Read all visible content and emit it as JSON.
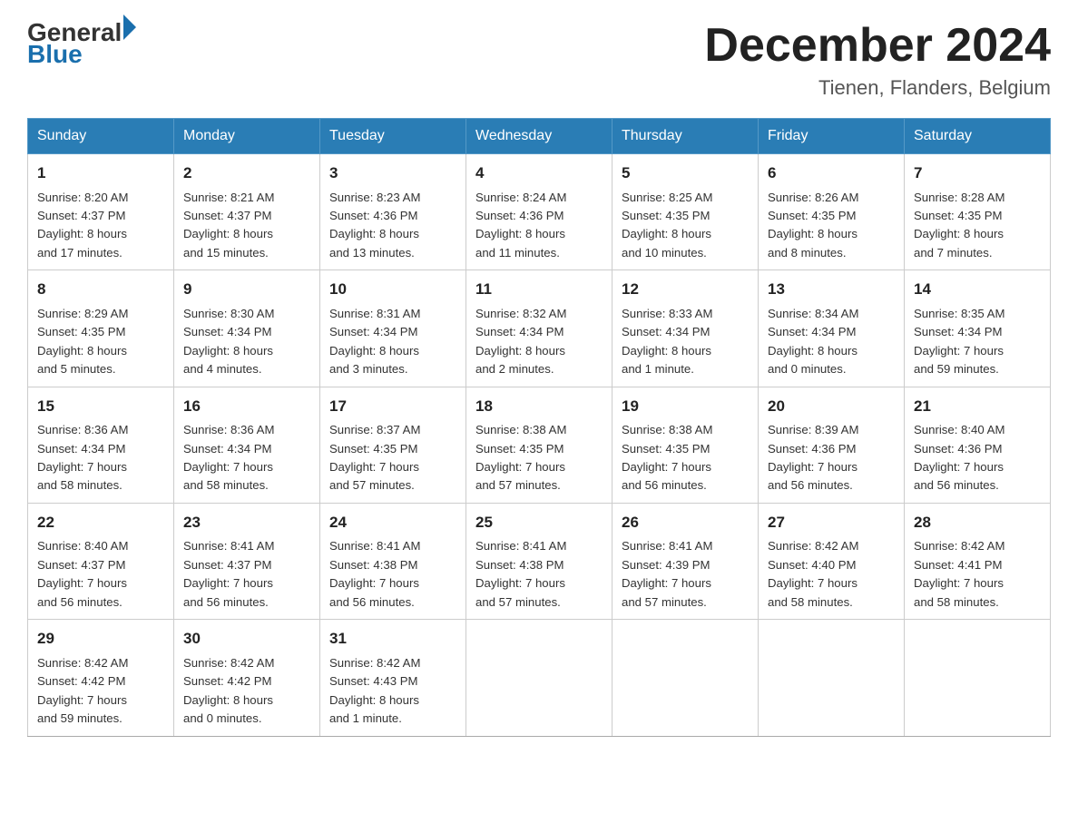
{
  "logo": {
    "general": "General",
    "blue": "Blue",
    "triangle_color": "#1a6fad"
  },
  "header": {
    "month_year": "December 2024",
    "location": "Tienen, Flanders, Belgium"
  },
  "days_of_week": [
    "Sunday",
    "Monday",
    "Tuesday",
    "Wednesday",
    "Thursday",
    "Friday",
    "Saturday"
  ],
  "weeks": [
    [
      {
        "day": "1",
        "sunrise": "8:20 AM",
        "sunset": "4:37 PM",
        "daylight": "8 hours and 17 minutes."
      },
      {
        "day": "2",
        "sunrise": "8:21 AM",
        "sunset": "4:37 PM",
        "daylight": "8 hours and 15 minutes."
      },
      {
        "day": "3",
        "sunrise": "8:23 AM",
        "sunset": "4:36 PM",
        "daylight": "8 hours and 13 minutes."
      },
      {
        "day": "4",
        "sunrise": "8:24 AM",
        "sunset": "4:36 PM",
        "daylight": "8 hours and 11 minutes."
      },
      {
        "day": "5",
        "sunrise": "8:25 AM",
        "sunset": "4:35 PM",
        "daylight": "8 hours and 10 minutes."
      },
      {
        "day": "6",
        "sunrise": "8:26 AM",
        "sunset": "4:35 PM",
        "daylight": "8 hours and 8 minutes."
      },
      {
        "day": "7",
        "sunrise": "8:28 AM",
        "sunset": "4:35 PM",
        "daylight": "8 hours and 7 minutes."
      }
    ],
    [
      {
        "day": "8",
        "sunrise": "8:29 AM",
        "sunset": "4:35 PM",
        "daylight": "8 hours and 5 minutes."
      },
      {
        "day": "9",
        "sunrise": "8:30 AM",
        "sunset": "4:34 PM",
        "daylight": "8 hours and 4 minutes."
      },
      {
        "day": "10",
        "sunrise": "8:31 AM",
        "sunset": "4:34 PM",
        "daylight": "8 hours and 3 minutes."
      },
      {
        "day": "11",
        "sunrise": "8:32 AM",
        "sunset": "4:34 PM",
        "daylight": "8 hours and 2 minutes."
      },
      {
        "day": "12",
        "sunrise": "8:33 AM",
        "sunset": "4:34 PM",
        "daylight": "8 hours and 1 minute."
      },
      {
        "day": "13",
        "sunrise": "8:34 AM",
        "sunset": "4:34 PM",
        "daylight": "8 hours and 0 minutes."
      },
      {
        "day": "14",
        "sunrise": "8:35 AM",
        "sunset": "4:34 PM",
        "daylight": "7 hours and 59 minutes."
      }
    ],
    [
      {
        "day": "15",
        "sunrise": "8:36 AM",
        "sunset": "4:34 PM",
        "daylight": "7 hours and 58 minutes."
      },
      {
        "day": "16",
        "sunrise": "8:36 AM",
        "sunset": "4:34 PM",
        "daylight": "7 hours and 58 minutes."
      },
      {
        "day": "17",
        "sunrise": "8:37 AM",
        "sunset": "4:35 PM",
        "daylight": "7 hours and 57 minutes."
      },
      {
        "day": "18",
        "sunrise": "8:38 AM",
        "sunset": "4:35 PM",
        "daylight": "7 hours and 57 minutes."
      },
      {
        "day": "19",
        "sunrise": "8:38 AM",
        "sunset": "4:35 PM",
        "daylight": "7 hours and 56 minutes."
      },
      {
        "day": "20",
        "sunrise": "8:39 AM",
        "sunset": "4:36 PM",
        "daylight": "7 hours and 56 minutes."
      },
      {
        "day": "21",
        "sunrise": "8:40 AM",
        "sunset": "4:36 PM",
        "daylight": "7 hours and 56 minutes."
      }
    ],
    [
      {
        "day": "22",
        "sunrise": "8:40 AM",
        "sunset": "4:37 PM",
        "daylight": "7 hours and 56 minutes."
      },
      {
        "day": "23",
        "sunrise": "8:41 AM",
        "sunset": "4:37 PM",
        "daylight": "7 hours and 56 minutes."
      },
      {
        "day": "24",
        "sunrise": "8:41 AM",
        "sunset": "4:38 PM",
        "daylight": "7 hours and 56 minutes."
      },
      {
        "day": "25",
        "sunrise": "8:41 AM",
        "sunset": "4:38 PM",
        "daylight": "7 hours and 57 minutes."
      },
      {
        "day": "26",
        "sunrise": "8:41 AM",
        "sunset": "4:39 PM",
        "daylight": "7 hours and 57 minutes."
      },
      {
        "day": "27",
        "sunrise": "8:42 AM",
        "sunset": "4:40 PM",
        "daylight": "7 hours and 58 minutes."
      },
      {
        "day": "28",
        "sunrise": "8:42 AM",
        "sunset": "4:41 PM",
        "daylight": "7 hours and 58 minutes."
      }
    ],
    [
      {
        "day": "29",
        "sunrise": "8:42 AM",
        "sunset": "4:42 PM",
        "daylight": "7 hours and 59 minutes."
      },
      {
        "day": "30",
        "sunrise": "8:42 AM",
        "sunset": "4:42 PM",
        "daylight": "8 hours and 0 minutes."
      },
      {
        "day": "31",
        "sunrise": "8:42 AM",
        "sunset": "4:43 PM",
        "daylight": "8 hours and 1 minute."
      },
      null,
      null,
      null,
      null
    ]
  ],
  "labels": {
    "sunrise": "Sunrise:",
    "sunset": "Sunset:",
    "daylight": "Daylight:"
  }
}
